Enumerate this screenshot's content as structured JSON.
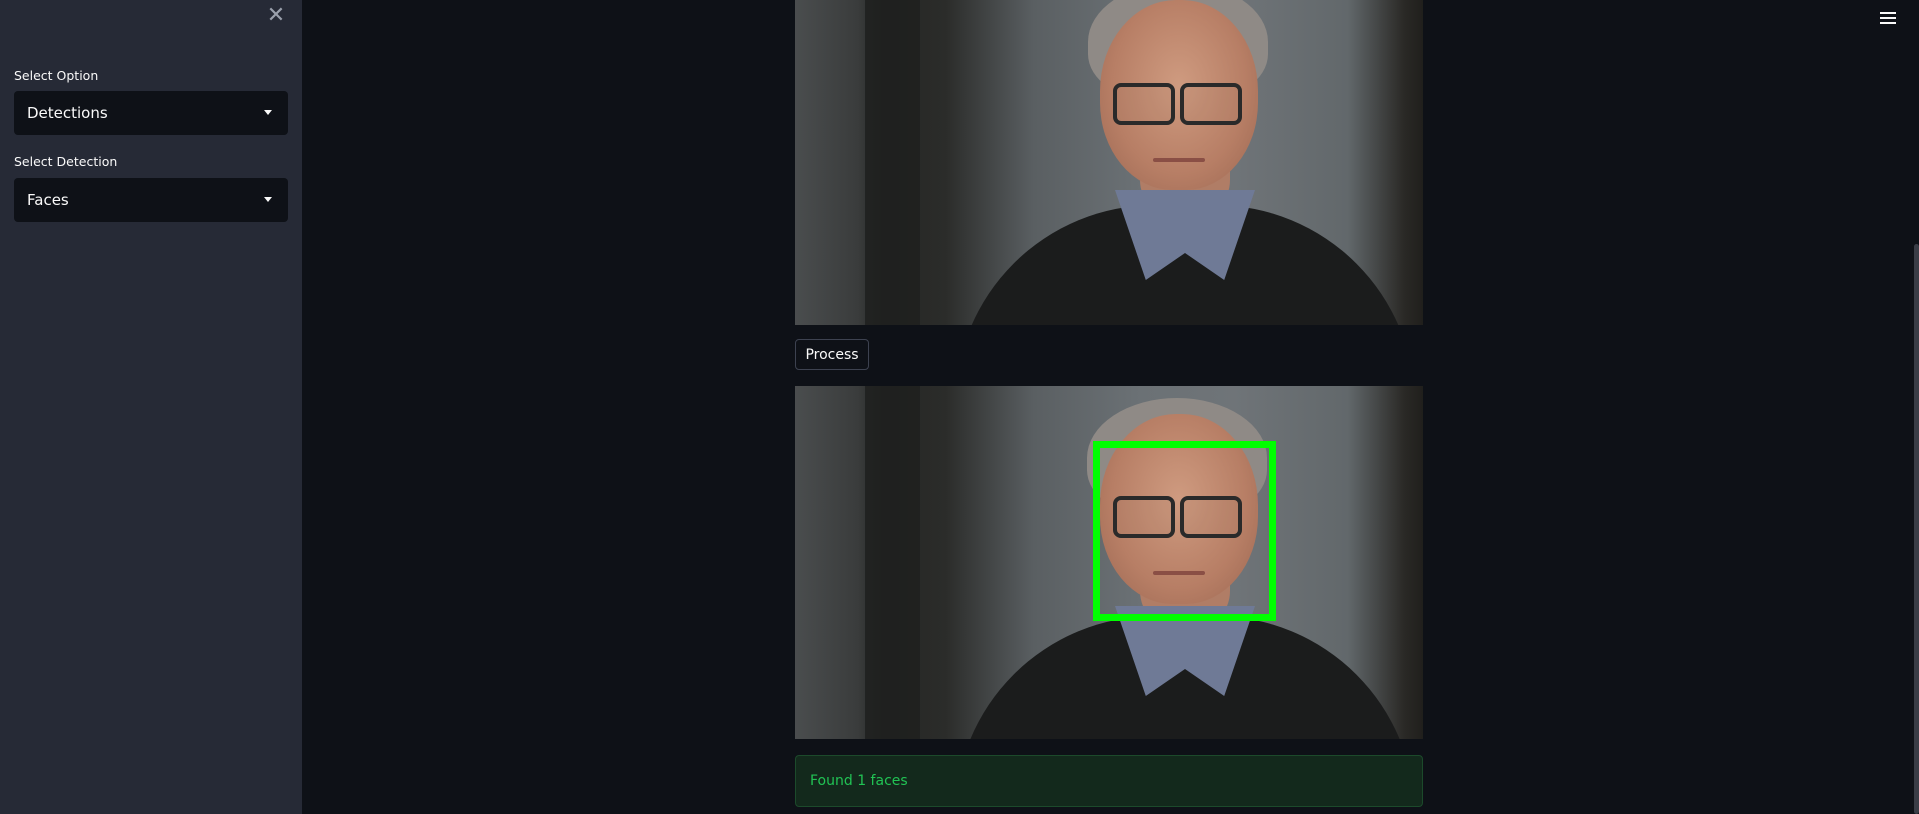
{
  "sidebar": {
    "close_icon": "close-icon",
    "select_option": {
      "label": "Select Option",
      "value": "Detections"
    },
    "select_detection": {
      "label": "Select Detection",
      "value": "Faces"
    }
  },
  "main": {
    "menu_icon": "hamburger-menu-icon",
    "process_button_label": "Process",
    "result_message": "Found 1 faces",
    "detection_box_color": "#00ff00",
    "success_text_color": "#21c354"
  }
}
